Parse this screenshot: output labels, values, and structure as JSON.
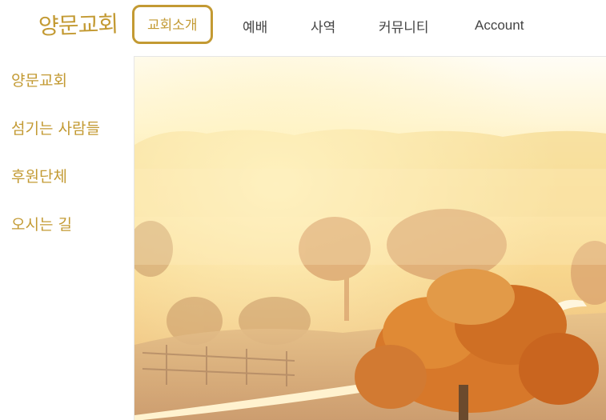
{
  "logo": {
    "text": "양문교회"
  },
  "nav": {
    "items": [
      {
        "label": "교회소개",
        "active": true
      },
      {
        "label": "예배"
      },
      {
        "label": "사역"
      },
      {
        "label": "커뮤니티"
      },
      {
        "label": "Account"
      }
    ]
  },
  "sidebar": {
    "items": [
      {
        "label": "양문교회"
      },
      {
        "label": "섬기는 사람들"
      },
      {
        "label": "후원단체"
      },
      {
        "label": "오시는 길"
      }
    ]
  },
  "colors": {
    "accent": "#c39a33",
    "nav_text": "#444444"
  },
  "hero": {
    "image": "misty-autumn-landscape"
  }
}
